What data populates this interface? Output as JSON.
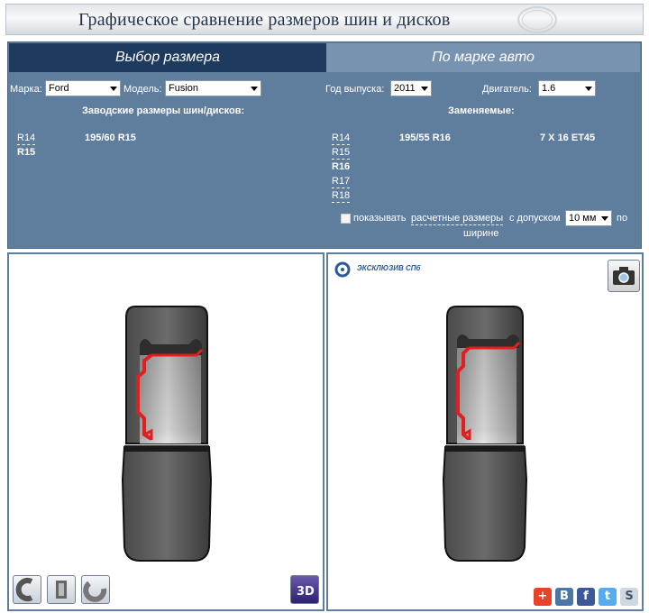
{
  "header": {
    "title": "Графическое сравнение размеров шин и дисков"
  },
  "tabs": [
    {
      "label": "Выбор размера"
    },
    {
      "label": "По марке авто"
    }
  ],
  "form": {
    "brand_label": "Марка:",
    "brand_value": "Ford",
    "model_label": "Модель:",
    "model_value": "Fusion",
    "year_label": "Год выпуска:",
    "year_value": "2011",
    "engine_label": "Двигатель:",
    "engine_value": "1.6"
  },
  "factory": {
    "heading": "Заводские размеры шин/дисков:",
    "radii": [
      "R14",
      "R15"
    ],
    "tire_size": "195/60 R15"
  },
  "replacement": {
    "heading": "Заменяемые:",
    "radii": [
      "R14",
      "R15",
      "R16",
      "R17",
      "R18"
    ],
    "tire_size": "195/55 R16",
    "rim_size": "7 X 16 ET45"
  },
  "options": {
    "show_label": "показывать",
    "calc_link": "расчетные размеры",
    "tolerance_label": "с допуском",
    "tolerance_value": "10 мм",
    "by_label": "по",
    "width_label": "ширине"
  },
  "logo": {
    "text": "ЭКСКЛЮЗИВ СПб"
  },
  "colors": {
    "panel": "#5f7e9e",
    "active_tab": "#1e3a5c",
    "inactive_tab": "#7893b0",
    "rim_profile": "#e02020"
  },
  "icons": [
    "section-view-icon",
    "tire-front-icon",
    "rim-side-icon",
    "3d-view-icon",
    "camera-icon",
    "add-share-icon",
    "vkontakte-icon",
    "facebook-icon",
    "twitter-icon",
    "skype-icon"
  ]
}
